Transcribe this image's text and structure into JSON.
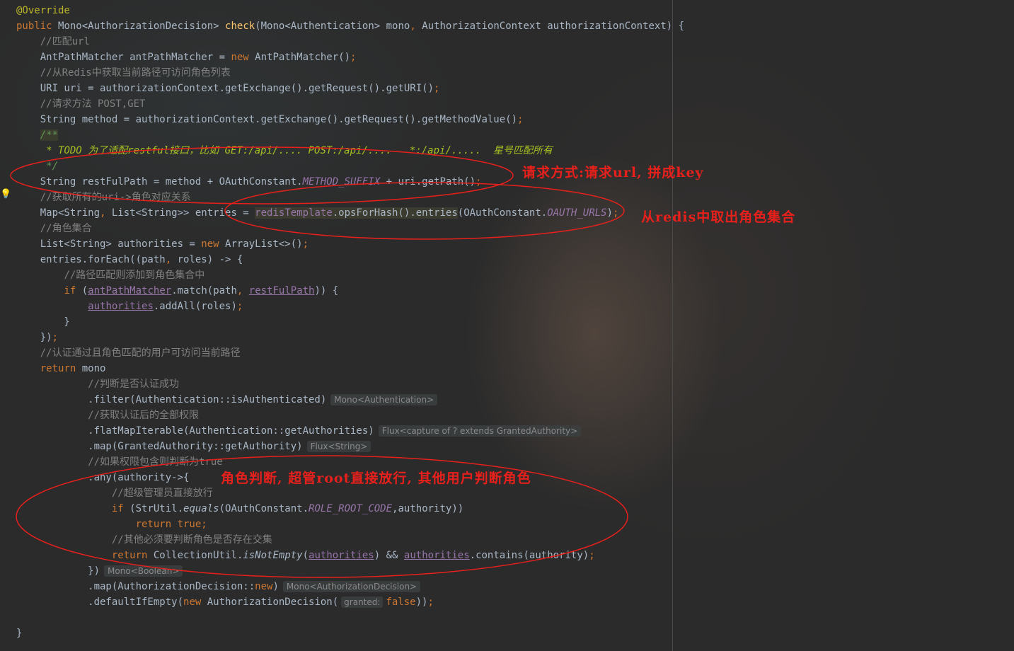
{
  "editor": {
    "lines": [
      [
        {
          "t": "@Override",
          "c": "ann"
        }
      ],
      [
        {
          "t": "public ",
          "c": "kw"
        },
        {
          "t": "Mono<AuthorizationDecision> "
        },
        {
          "t": "check",
          "c": "fn"
        },
        {
          "t": "(Mono<Authentication> mono"
        },
        {
          "t": ", ",
          "c": "kw"
        },
        {
          "t": "AuthorizationContext authorizationContext) {"
        }
      ],
      [
        {
          "t": "    "
        },
        {
          "t": "//匹配url",
          "c": "cm"
        }
      ],
      [
        {
          "t": "    AntPathMatcher antPathMatcher = "
        },
        {
          "t": "new ",
          "c": "kw"
        },
        {
          "t": "AntPathMatcher()"
        },
        {
          "t": ";",
          "c": "kw"
        }
      ],
      [
        {
          "t": "    "
        },
        {
          "t": "//从Redis中获取当前路径可访问角色列表",
          "c": "cm"
        }
      ],
      [
        {
          "t": "    URI uri = authorizationContext.getExchange().getRequest().getURI()"
        },
        {
          "t": ";",
          "c": "kw"
        }
      ],
      [
        {
          "t": "    "
        },
        {
          "t": "//请求方法 POST,GET",
          "c": "cm"
        }
      ],
      [
        {
          "t": "    String method = authorizationContext.getExchange().getRequest().getMethodValue()"
        },
        {
          "t": ";",
          "c": "kw"
        }
      ],
      [
        {
          "t": "    "
        },
        {
          "t": "/**",
          "c": "doc hl2"
        }
      ],
      [
        {
          "t": "     "
        },
        {
          "t": "* TODO 为了适配restful接口，比如 GET:/api/.... POST:/api/....   *:/api/.....  星号匹配所有",
          "c": "todo"
        }
      ],
      [
        {
          "t": "     "
        },
        {
          "t": "*/",
          "c": "doc"
        }
      ],
      [
        {
          "t": "    String restFulPath = method + OAuthConstant."
        },
        {
          "t": "METHOD_SUFFIX",
          "c": "const"
        },
        {
          "t": " + uri.getPath()"
        },
        {
          "t": ";",
          "c": "kw"
        }
      ],
      [
        {
          "t": "    "
        },
        {
          "t": "//获取所有的uri->角色对应关系",
          "c": "cm"
        }
      ],
      [
        {
          "t": "    Map<String"
        },
        {
          "t": ", ",
          "c": "kw"
        },
        {
          "t": "List<String>> entries = "
        },
        {
          "t": "redisTemplate",
          "c": "field hl"
        },
        {
          "t": ".opsForHash().entries",
          "c": "hl"
        },
        {
          "t": "(OAuthConstant."
        },
        {
          "t": "OAUTH_URLS",
          "c": "const"
        },
        {
          "t": ")"
        },
        {
          "t": ";",
          "c": "kw"
        }
      ],
      [
        {
          "t": "    "
        },
        {
          "t": "//角色集合",
          "c": "cm"
        }
      ],
      [
        {
          "t": "    List<String> authorities = "
        },
        {
          "t": "new ",
          "c": "kw"
        },
        {
          "t": "ArrayList<>()"
        },
        {
          "t": ";",
          "c": "kw"
        }
      ],
      [
        {
          "t": "    entries.forEach((path"
        },
        {
          "t": ", ",
          "c": "kw"
        },
        {
          "t": "roles) -> {"
        }
      ],
      [
        {
          "t": "        "
        },
        {
          "t": "//路径匹配则添加到角色集合中",
          "c": "cm"
        }
      ],
      [
        {
          "t": "        "
        },
        {
          "t": "if ",
          "c": "kw"
        },
        {
          "t": "("
        },
        {
          "t": "antPathMatcher",
          "c": "field ul"
        },
        {
          "t": ".match(path"
        },
        {
          "t": ", ",
          "c": "kw"
        },
        {
          "t": "restFulPath",
          "c": "field ul"
        },
        {
          "t": ")) {"
        }
      ],
      [
        {
          "t": "            "
        },
        {
          "t": "authorities",
          "c": "field ul"
        },
        {
          "t": ".addAll(roles)"
        },
        {
          "t": ";",
          "c": "kw"
        }
      ],
      [
        {
          "t": "        }"
        }
      ],
      [
        {
          "t": "    })"
        },
        {
          "t": ";",
          "c": "kw"
        }
      ],
      [
        {
          "t": "    "
        },
        {
          "t": "//认证通过且角色匹配的用户可访问当前路径",
          "c": "cm"
        }
      ],
      [
        {
          "t": "    "
        },
        {
          "t": "return ",
          "c": "kw"
        },
        {
          "t": "mono"
        }
      ],
      [
        {
          "t": "            "
        },
        {
          "t": "//判断是否认证成功",
          "c": "cm"
        }
      ],
      [
        {
          "t": "            .filter(Authentication::isAuthenticated)"
        },
        {
          "t": "Mono<Authentication>",
          "c": "hint"
        }
      ],
      [
        {
          "t": "            "
        },
        {
          "t": "//获取认证后的全部权限",
          "c": "cm"
        }
      ],
      [
        {
          "t": "            .flatMapIterable(Authentication::getAuthorities)"
        },
        {
          "t": "Flux<capture of ? extends GrantedAuthority>",
          "c": "hint"
        }
      ],
      [
        {
          "t": "            .map(GrantedAuthority::getAuthority)"
        },
        {
          "t": "Flux<String>",
          "c": "hint"
        }
      ],
      [
        {
          "t": "            "
        },
        {
          "t": "//如果权限包含则判断为true",
          "c": "cm"
        }
      ],
      [
        {
          "t": "            .any(authority->{"
        }
      ],
      [
        {
          "t": "                "
        },
        {
          "t": "//超级管理员直接放行",
          "c": "cm"
        }
      ],
      [
        {
          "t": "                "
        },
        {
          "t": "if ",
          "c": "kw"
        },
        {
          "t": "(StrUtil."
        },
        {
          "t": "equals",
          "c": "ital"
        },
        {
          "t": "(OAuthConstant."
        },
        {
          "t": "ROLE_ROOT_CODE",
          "c": "const"
        },
        {
          "t": ","
        },
        {
          "t": "authority))"
        }
      ],
      [
        {
          "t": "                    "
        },
        {
          "t": "return true",
          "c": "kw"
        },
        {
          "t": ";",
          "c": "kw"
        }
      ],
      [
        {
          "t": "                "
        },
        {
          "t": "//其他必须要判断角色是否存在交集",
          "c": "cm"
        }
      ],
      [
        {
          "t": "                "
        },
        {
          "t": "return ",
          "c": "kw"
        },
        {
          "t": "CollectionUtil."
        },
        {
          "t": "isNotEmpty",
          "c": "ital"
        },
        {
          "t": "("
        },
        {
          "t": "authorities",
          "c": "field ul"
        },
        {
          "t": ") && "
        },
        {
          "t": "authorities",
          "c": "field ul"
        },
        {
          "t": ".contains(authority)"
        },
        {
          "t": ";",
          "c": "kw"
        }
      ],
      [
        {
          "t": "            })"
        },
        {
          "t": "Mono<Boolean>",
          "c": "hint"
        }
      ],
      [
        {
          "t": "            .map(AuthorizationDecision::"
        },
        {
          "t": "new",
          "c": "kw"
        },
        {
          "t": ")"
        },
        {
          "t": "Mono<AuthorizationDecision>",
          "c": "hint"
        }
      ],
      [
        {
          "t": "            .defaultIfEmpty("
        },
        {
          "t": "new ",
          "c": "kw"
        },
        {
          "t": "AuthorizationDecision("
        },
        {
          "t": "granted:",
          "c": "param"
        },
        {
          "t": "false",
          "c": "kw"
        },
        {
          "t": "))"
        },
        {
          "t": ";",
          "c": "kw"
        }
      ],
      [
        {
          "t": ""
        }
      ],
      [
        {
          "t": "}"
        }
      ]
    ]
  },
  "annotations": {
    "note1": "请求方式:请求url, 拼成key",
    "note2": "从redis中取出角色集合",
    "note3": "角色判断, 超管root直接放行, 其他用户判断角色",
    "color": "#e8201c"
  }
}
